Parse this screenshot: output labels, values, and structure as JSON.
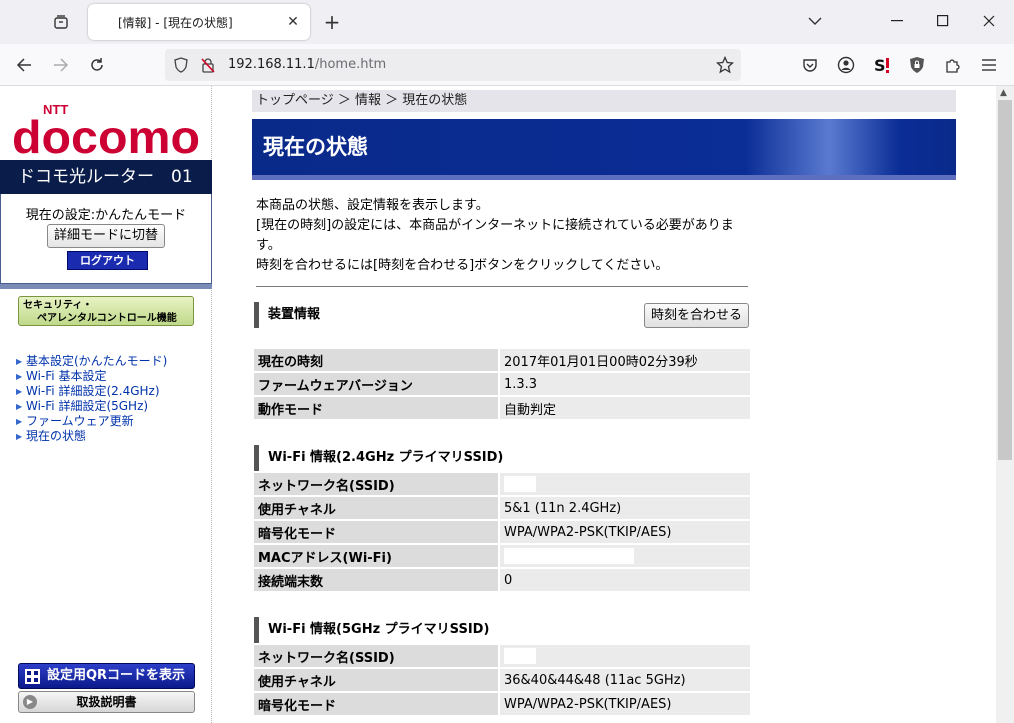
{
  "browser": {
    "tab_title": "[情報] - [現在の状態]",
    "tab_close": "✕",
    "new_tab": "+",
    "url_host": "192.168.11.1",
    "url_path": "/home.htm"
  },
  "sidebar": {
    "logo_sub": "NTT",
    "logo_main": "docomo",
    "model": "ドコモ光ルーター　01",
    "mode_label": "現在の設定:かんたんモード",
    "detail_button": "詳細モードに切替",
    "logout_button": "ログアウト",
    "security_line1": "セキュリティ・",
    "security_line2": "ペアレンタルコントロール機能",
    "menu": [
      "基本設定(かんたんモード)",
      "Wi-Fi 基本設定",
      "Wi-Fi 詳細設定(2.4GHz)",
      "Wi-Fi 詳細設定(5GHz)",
      "ファームウェア更新",
      "現在の状態"
    ],
    "qr_button": "設定用QRコードを表示",
    "manual_button": "取扱説明書"
  },
  "main": {
    "breadcrumb": "トップページ ＞ 情報 ＞ 現在の状態",
    "title": "現在の状態",
    "desc_line1": "本商品の状態、設定情報を表示します。",
    "desc_line2": "[現在の時刻]の設定には、本商品がインターネットに接続されている必要がありま",
    "desc_line3": "す。",
    "desc_line4": "時刻を合わせるには[時刻を合わせる]ボタンをクリックしてください。",
    "device_section": "装置情報",
    "sync_button": "時刻を合わせる",
    "device_rows": [
      {
        "k": "現在の時刻",
        "v": "2017年01月01日00時02分39秒"
      },
      {
        "k": "ファームウェアバージョン",
        "v": "1.3.3"
      },
      {
        "k": "動作モード",
        "v": "自動判定"
      }
    ],
    "wifi24_section": "Wi-Fi 情報(2.4GHz プライマリSSID)",
    "wifi24_rows": [
      {
        "k": "ネットワーク名(SSID)",
        "v": ""
      },
      {
        "k": "使用チャネル",
        "v": "5&1 (11n 2.4GHz)"
      },
      {
        "k": "暗号化モード",
        "v": "WPA/WPA2-PSK(TKIP/AES)"
      },
      {
        "k": "MACアドレス(Wi-Fi)",
        "v": ""
      },
      {
        "k": "接続端末数",
        "v": "0"
      }
    ],
    "wifi5_section": "Wi-Fi 情報(5GHz プライマリSSID)",
    "wifi5_rows": [
      {
        "k": "ネットワーク名(SSID)",
        "v": ""
      },
      {
        "k": "使用チャネル",
        "v": "36&40&44&48 (11ac 5GHz)"
      },
      {
        "k": "暗号化モード",
        "v": "WPA/WPA2-PSK(TKIP/AES)"
      }
    ]
  },
  "colors": {
    "brand_red": "#cc0033",
    "title_blue": "#0a2a8a",
    "link_blue": "#0033aa"
  }
}
